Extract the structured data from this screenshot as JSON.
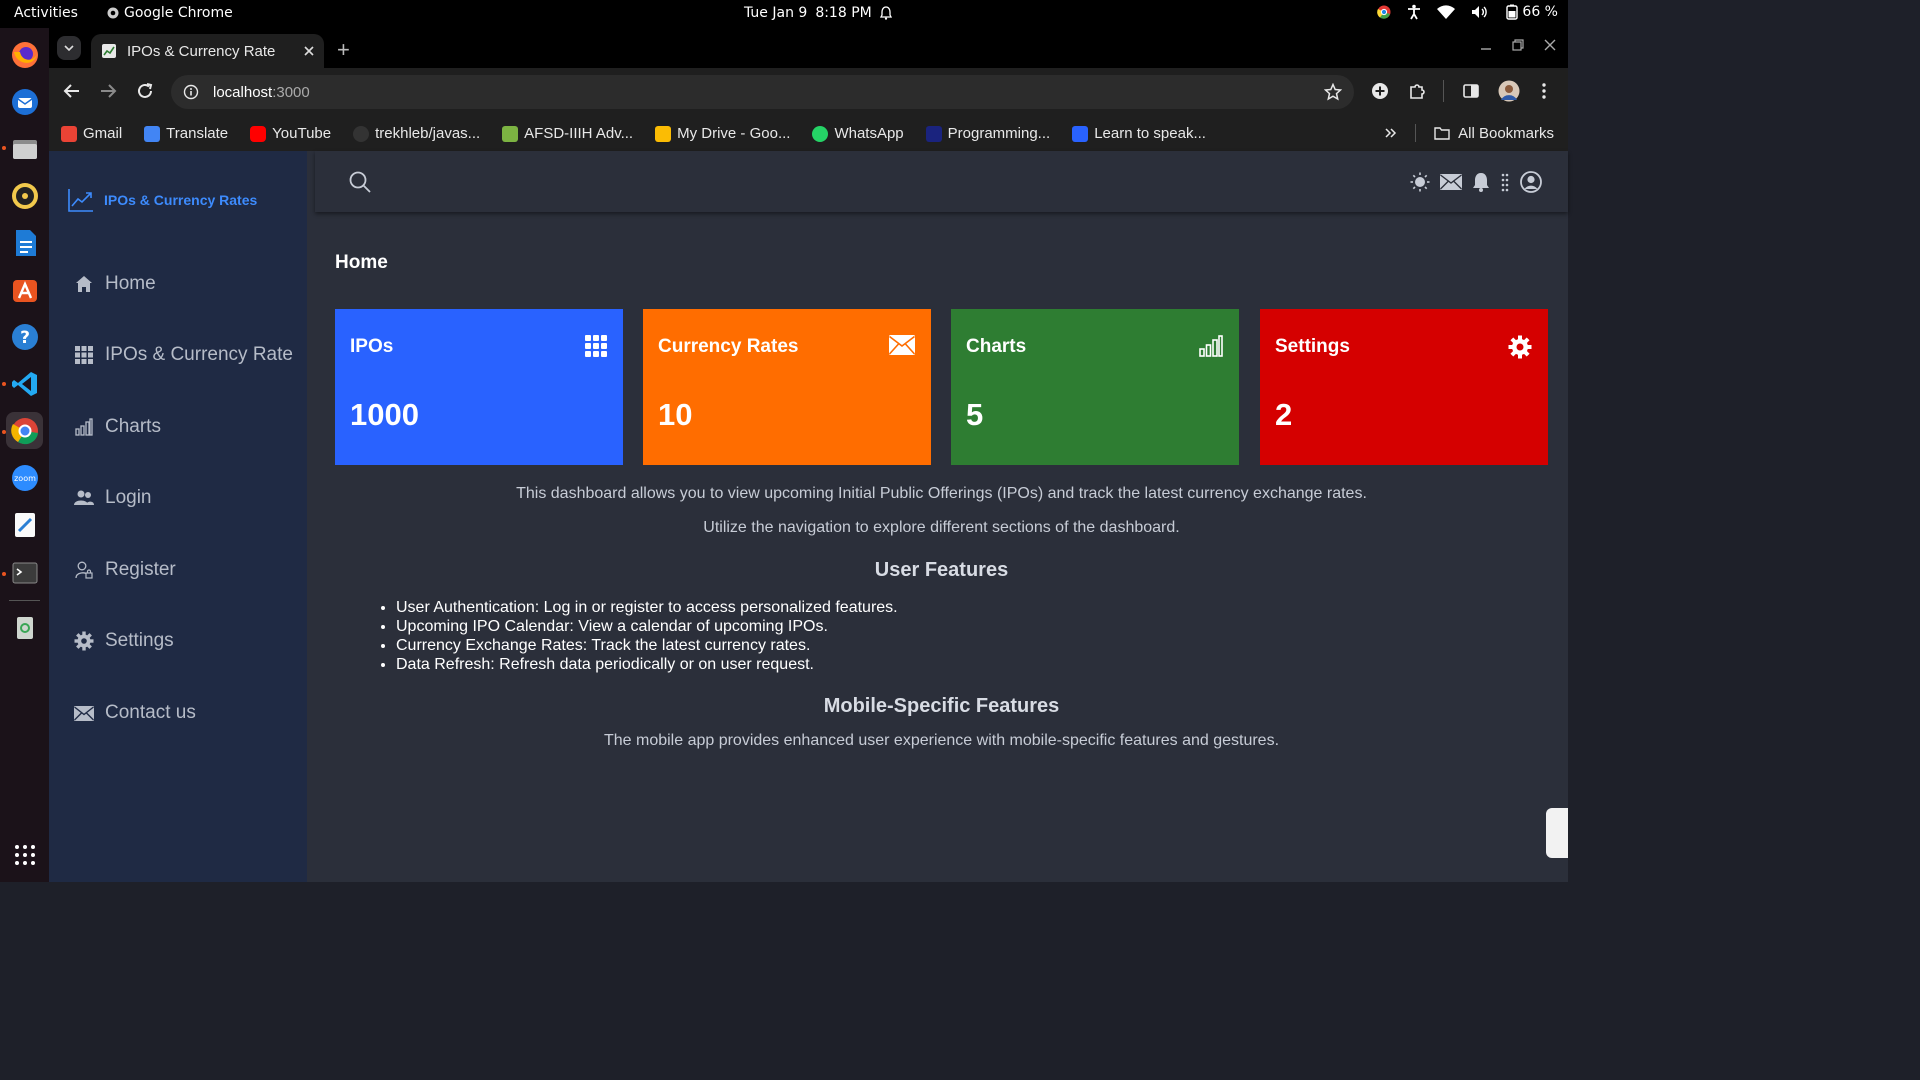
{
  "os": {
    "activities": "Activities",
    "app_name": "Google Chrome",
    "date": "Tue Jan 9",
    "time": "8:18 PM",
    "battery": "66 %"
  },
  "browser": {
    "tab_title": "IPOs & Currency Rate",
    "url_host": "localhost",
    "url_port": ":3000",
    "bookmarks": [
      {
        "label": "Gmail",
        "color": "#ea4335"
      },
      {
        "label": "Translate",
        "color": "#4285f4"
      },
      {
        "label": "YouTube",
        "color": "#ff0000"
      },
      {
        "label": "trekhleb/javas...",
        "color": "#333333"
      },
      {
        "label": "AFSD-IIIH Adv...",
        "color": "#7cb342"
      },
      {
        "label": "My Drive - Goo...",
        "color": "#fbbc04"
      },
      {
        "label": "WhatsApp",
        "color": "#25d366"
      },
      {
        "label": "Programming...",
        "color": "#1a237e"
      },
      {
        "label": "Learn to speak...",
        "color": "#2962ff"
      }
    ],
    "all_bookmarks": "All Bookmarks"
  },
  "app": {
    "brand": "IPOs & Currency Rates",
    "nav": [
      {
        "label": "Home",
        "icon": "home-icon"
      },
      {
        "label": "IPOs & Currency Rate",
        "icon": "grid-icon"
      },
      {
        "label": "Charts",
        "icon": "bar-chart-icon"
      },
      {
        "label": "Login",
        "icon": "users-icon"
      },
      {
        "label": "Register",
        "icon": "user-lock-icon"
      },
      {
        "label": "Settings",
        "icon": "gear-icon"
      },
      {
        "label": "Contact us",
        "icon": "envelope-icon"
      }
    ],
    "page_title": "Home",
    "cards": [
      {
        "title": "IPOs",
        "value": "1000",
        "color": "#2962ff",
        "icon": "grid-icon"
      },
      {
        "title": "Currency Rates",
        "value": "10",
        "color": "#ff6d00",
        "icon": "envelope-icon"
      },
      {
        "title": "Charts",
        "value": "5",
        "color": "#2e7d32",
        "icon": "bar-chart-icon"
      },
      {
        "title": "Settings",
        "value": "2",
        "color": "#d50000",
        "icon": "gear-icon"
      }
    ],
    "description_1": "This dashboard allows you to view upcoming Initial Public Offerings (IPOs) and track the latest currency exchange rates.",
    "description_2": "Utilize the navigation to explore different sections of the dashboard.",
    "user_features_title": "User Features",
    "user_features": [
      "User Authentication: Log in or register to access personalized features.",
      "Upcoming IPO Calendar: View a calendar of upcoming IPOs.",
      "Currency Exchange Rates: Track the latest currency rates.",
      "Data Refresh: Refresh data periodically or on user request."
    ],
    "mobile_title": "Mobile-Specific Features",
    "mobile_text": "The mobile app provides enhanced user experience with mobile-specific features and gestures."
  }
}
